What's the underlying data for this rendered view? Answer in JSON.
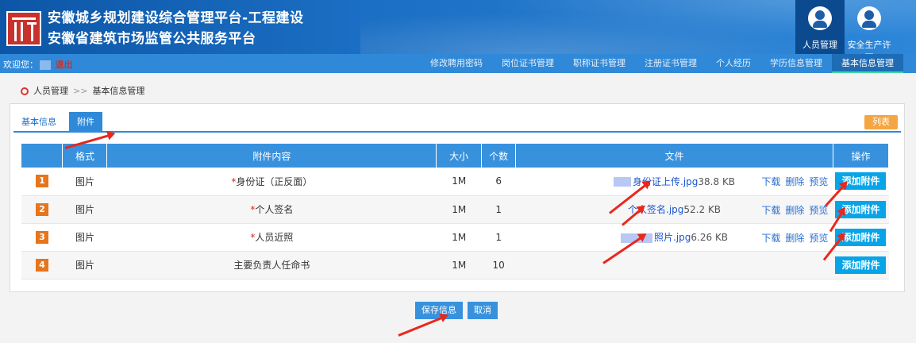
{
  "header": {
    "title_line1": "安徽城乡规划建设综合管理平台-工程建设",
    "title_line2": "安徽省建筑市场监管公共服务平台",
    "nav": [
      {
        "label": "人员管理",
        "active": true
      },
      {
        "label": "安全生产许可",
        "active": false
      }
    ]
  },
  "menubar": {
    "welcome_label": "欢迎您：",
    "logout_label": "退出",
    "items": [
      "修改聘用密码",
      "岗位证书管理",
      "职称证书管理",
      "注册证书管理",
      "个人经历",
      "学历信息管理",
      "基本信息管理"
    ],
    "active_index": 6
  },
  "breadcrumb": {
    "root": "人员管理",
    "separator": ">>",
    "current": "基本信息管理"
  },
  "tabs": {
    "basic_info": "基本信息",
    "attachments": "附件",
    "list_button": "列表"
  },
  "table": {
    "headers": [
      "",
      "格式",
      "附件内容",
      "大小",
      "个数",
      "文件",
      "操作"
    ],
    "rows": [
      {
        "index": "1",
        "format": "图片",
        "required": true,
        "content": "身份证（正反面）",
        "size": "1M",
        "count": "6",
        "file_name": "身份证上传.jpg",
        "file_size": "38.8 KB",
        "has_file": true
      },
      {
        "index": "2",
        "format": "图片",
        "required": true,
        "content": "个人签名",
        "size": "1M",
        "count": "1",
        "file_name": "个人签名.jpg",
        "file_size": "52.2 KB",
        "has_file": true
      },
      {
        "index": "3",
        "format": "图片",
        "required": true,
        "content": "人员近照",
        "size": "1M",
        "count": "1",
        "file_name": "照片.jpg",
        "file_size": "6.26 KB",
        "has_file": true
      },
      {
        "index": "4",
        "format": "图片",
        "required": false,
        "content": "主要负责人任命书",
        "size": "1M",
        "count": "10",
        "file_name": "",
        "file_size": "",
        "has_file": false
      }
    ],
    "required_mark": "*",
    "download_label": "下载",
    "delete_label": "删除",
    "preview_label": "预览",
    "add_label": "添加附件"
  },
  "footer": {
    "save_label": "保存信息",
    "cancel_label": "取消"
  },
  "colors": {
    "header_blue": "#1b6fc4",
    "menubar_blue": "#2f89d8",
    "add_button": "#08a4e8",
    "index_badge": "#e6751c",
    "required_red": "#d0281c",
    "annotation_red": "#e8281c"
  }
}
